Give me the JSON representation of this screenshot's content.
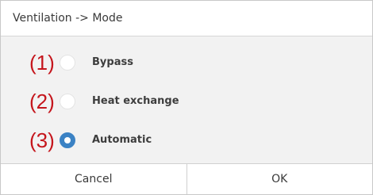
{
  "dialog": {
    "title": "Ventilation -> Mode",
    "options": [
      {
        "marker": "(1)",
        "label": "Bypass",
        "selected": false
      },
      {
        "marker": "(2)",
        "label": "Heat exchange",
        "selected": false
      },
      {
        "marker": "(3)",
        "label": "Automatic",
        "selected": true
      }
    ],
    "cancel_label": "Cancel",
    "ok_label": "OK"
  },
  "colors": {
    "accent": "#3b82c4",
    "marker": "#c5161d",
    "panel_bg": "#f2f2f2"
  }
}
